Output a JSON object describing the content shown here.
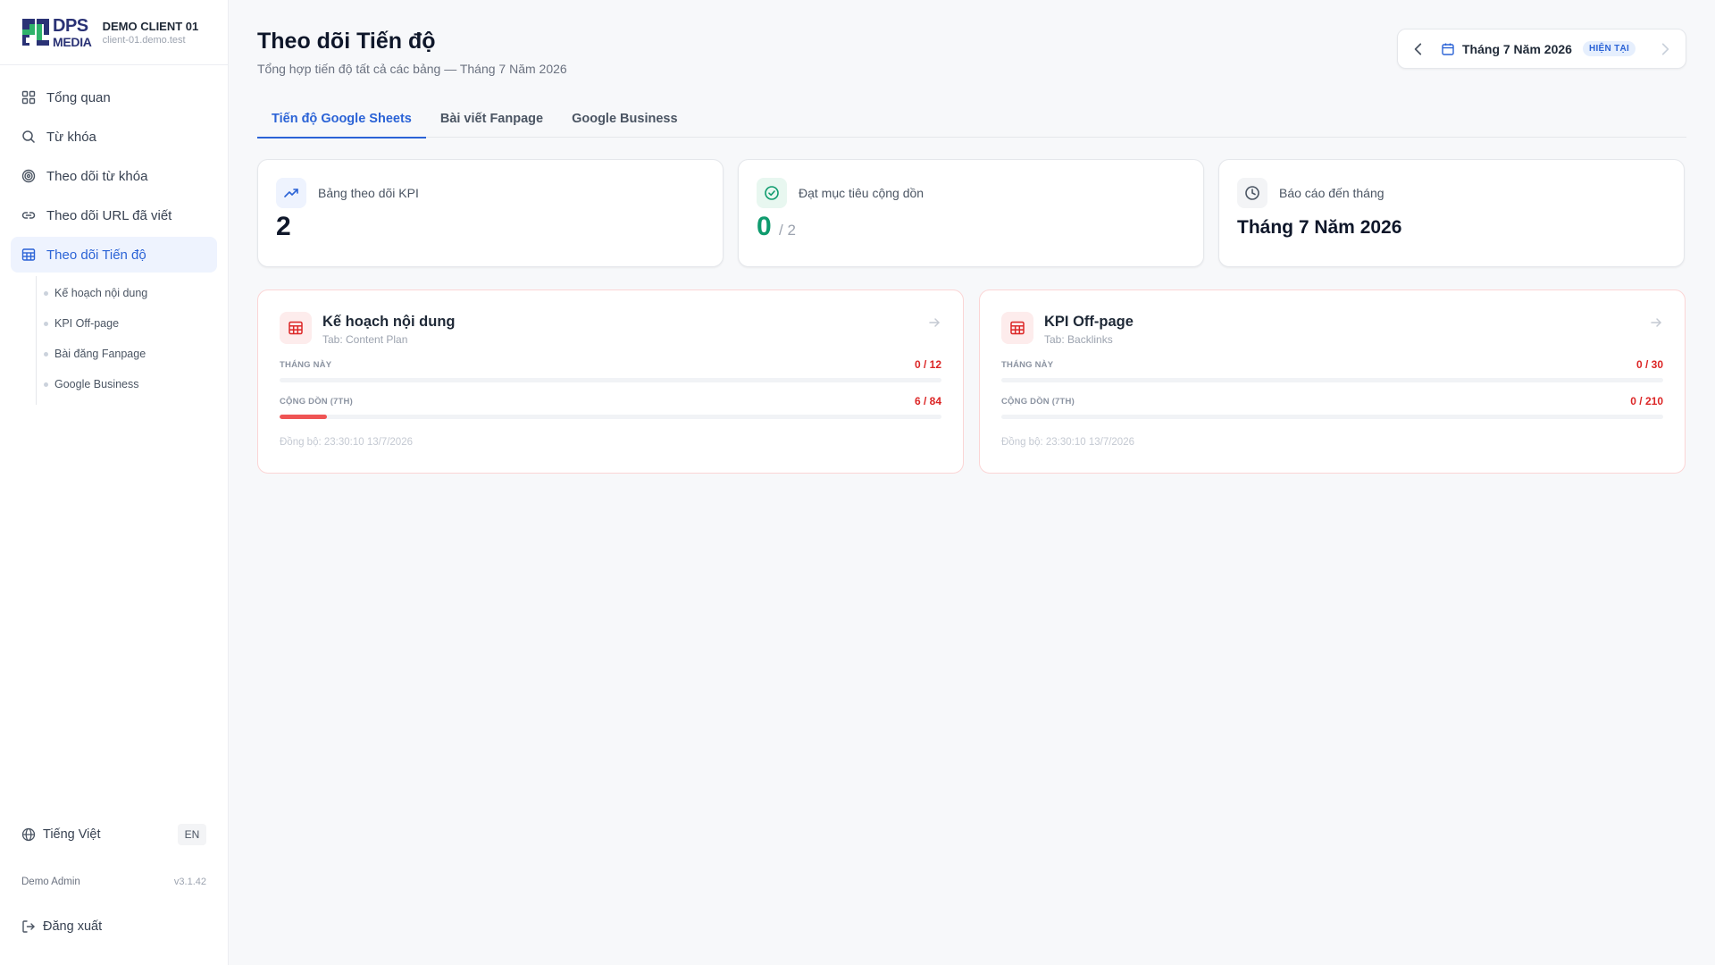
{
  "brand": {
    "logo_line1": "DPS",
    "logo_line2": "MEDIA",
    "client_name": "DEMO CLIENT 01",
    "client_domain": "client-01.demo.test"
  },
  "sidebar": {
    "items": [
      {
        "label": "Tổng quan",
        "icon": "grid-icon"
      },
      {
        "label": "Từ khóa",
        "icon": "search-icon"
      },
      {
        "label": "Theo dõi từ khóa",
        "icon": "target-icon"
      },
      {
        "label": "Theo dõi URL đã viết",
        "icon": "link-icon"
      },
      {
        "label": "Theo dõi Tiến độ",
        "icon": "table-icon",
        "active": true
      }
    ],
    "subitems": [
      "Kế hoạch nội dung",
      "KPI Off-page",
      "Bài đăng Fanpage",
      "Google Business"
    ],
    "language": "Tiếng Việt",
    "language_switch": "EN",
    "user": "Demo Admin",
    "version": "v3.1.42",
    "logout": "Đăng xuất"
  },
  "header": {
    "title": "Theo dõi Tiến độ",
    "subtitle": "Tổng hợp tiến độ tất cả các bảng — Tháng 7 Năm 2026",
    "month_label": "Tháng 7 Năm 2026",
    "current_badge": "HIỆN TẠI"
  },
  "tabs": [
    {
      "label": "Tiến độ Google Sheets",
      "active": true
    },
    {
      "label": "Bài viết Fanpage"
    },
    {
      "label": "Google Business"
    }
  ],
  "stats": [
    {
      "label": "Bảng theo dõi KPI",
      "value": "2",
      "icon": "trend-up-icon"
    },
    {
      "label": "Đạt mục tiêu cộng dồn",
      "value": "0",
      "of": "/ 2",
      "icon": "check-circle-icon"
    },
    {
      "label": "Báo cáo đến tháng",
      "value": "Tháng 7 Năm 2026",
      "icon": "clock-icon"
    }
  ],
  "cards": [
    {
      "title": "Kế hoạch nội dung",
      "tab": "Tab: Content Plan",
      "month_label": "THÁNG NÀY",
      "month_value": "0 / 12",
      "month_progress": 0,
      "cumulative_label": "CỘNG DỒN (7TH)",
      "cumulative_value": "6 / 84",
      "cumulative_progress": 0.0714,
      "sync": "Đồng bộ: 23:30:10 13/7/2026"
    },
    {
      "title": "KPI Off-page",
      "tab": "Tab: Backlinks",
      "month_label": "THÁNG NÀY",
      "month_value": "0 / 30",
      "month_progress": 0,
      "cumulative_label": "CỘNG DỒN (7TH)",
      "cumulative_value": "0 / 210",
      "cumulative_progress": 0,
      "sync": "Đồng bộ: 23:30:10 13/7/2026"
    }
  ],
  "colors": {
    "accent": "#2b63d6",
    "danger": "#dc2626",
    "success": "#0f9b6e",
    "progress": "#ef5454"
  }
}
